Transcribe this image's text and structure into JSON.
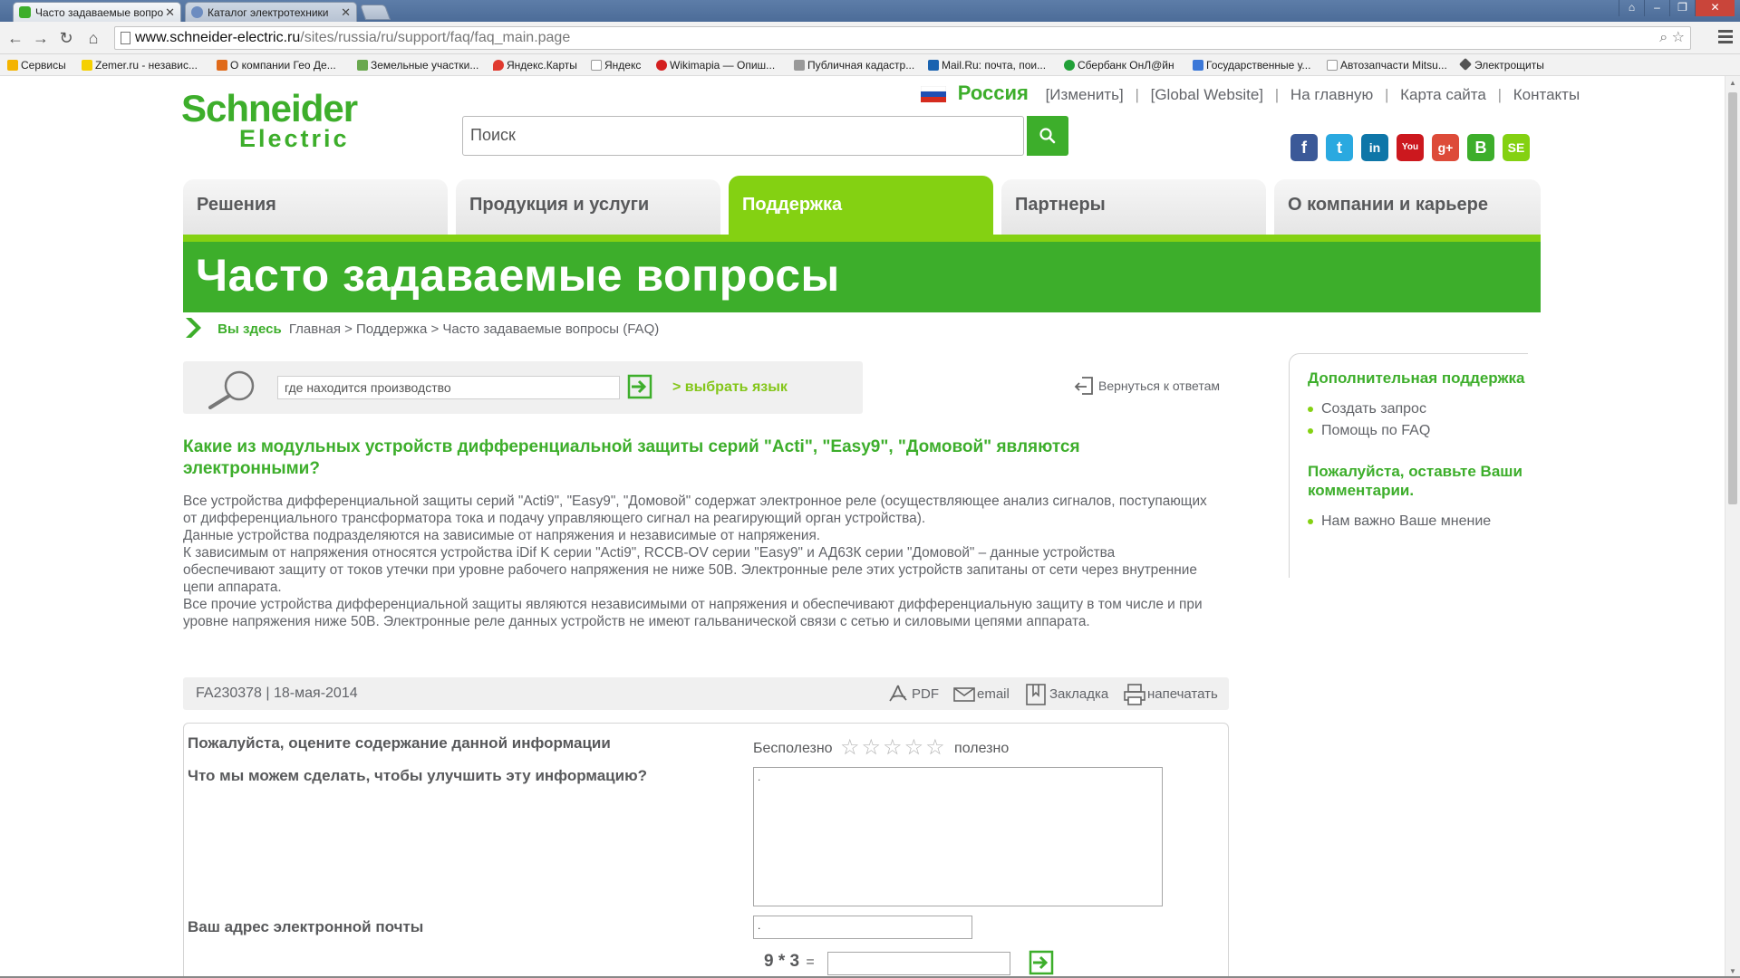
{
  "browser": {
    "tabs": [
      {
        "title": "Часто задаваемые вопро",
        "active": true
      },
      {
        "title": "Каталог электротехники",
        "active": false
      }
    ],
    "url_host": "www.schneider-electric.ru",
    "url_path": "/sites/russia/ru/support/faq/faq_main.page",
    "bookmarks": [
      "Сервисы",
      "Zemer.ru - независ...",
      "О компании Гео Де...",
      "Земельные участки...",
      "Яндекс.Карты",
      "Яндекс",
      "Wikimapia — Опиш...",
      "Публичная кадастр...",
      "Mail.Ru: почта, пои...",
      "Сбербанк ОнЛ@йн",
      "Государственные у...",
      "Автозапчасти Mitsu...",
      "Электрощиты"
    ]
  },
  "header": {
    "logo_line1": "Schneider",
    "logo_line2": "Electric",
    "country": "Россия",
    "top_links": [
      "[Изменить]",
      "[Global Website]",
      "На главную",
      "Карта сайта",
      "Контакты"
    ],
    "search_placeholder": "Поиск",
    "social": [
      {
        "name": "facebook-icon",
        "glyph": "f",
        "color": "#3b5998"
      },
      {
        "name": "twitter-icon",
        "glyph": "t",
        "color": "#2aa9e0"
      },
      {
        "name": "linkedin-icon",
        "glyph": "in",
        "color": "#0e76a8"
      },
      {
        "name": "youtube-icon",
        "glyph": "You",
        "color": "#cc181e"
      },
      {
        "name": "googleplus-icon",
        "glyph": "g+",
        "color": "#dd4b39"
      },
      {
        "name": "vkontakte-icon",
        "glyph": "B",
        "color": "#3dae2b"
      },
      {
        "name": "setv-icon",
        "glyph": "SE",
        "color": "#84d112"
      }
    ]
  },
  "nav": {
    "tabs": [
      "Решения",
      "Продукция и услуги",
      "Поддержка",
      "Партнеры",
      "О компании и карьере"
    ],
    "active_index": 2
  },
  "page_title": "Часто задаваемые вопросы",
  "breadcrumb": {
    "you_are_here": "Вы здесь",
    "path": "Главная > Поддержка > Часто задаваемые вопросы (FAQ)"
  },
  "faq_search": {
    "value": "где находится производство",
    "lang_link": ">  выбрать язык"
  },
  "back_link": "Вернуться к ответам",
  "question": "Какие из модульных устройств дифференциальной защиты серий \"Acti\", \"Easy9\", \"Домовой\" являются электронными?",
  "answer": [
    "Все устройства дифференциальной защиты серий \"Acti9\", \"Easy9\", \"Домовой\" содержат электронное реле (осуществляющее анализ сигналов, поступающих от дифференциального трансформатора тока и подачу управляющего сигнал на реагирующий орган устройства).",
    "Данные устройства подразделяются на зависимые от напряжения и независимые от напряжения.",
    "К зависимым от напряжения относятся устройства iDif K серии \"Acti9\",  RCCB-OV серии \"Easy9\" и АД63К серии \"Домовой\" – данные устройства обеспечивают защиту от токов утечки при уровне рабочего напряжения не ниже 50В. Электронные реле этих устройств запитаны от сети через внутренние цепи аппарата.",
    "Все прочие устройства дифференциальной защиты являются независимыми от напряжения и обеспечивают дифференциальную защиту в том числе и при уровне напряжения ниже 50В. Электронные реле данных устройств не имеют гальванической связи с сетью и силовыми цепями аппарата."
  ],
  "meta": {
    "code": "FA230378",
    "date": "| 18-мая-2014",
    "actions": [
      "PDF",
      "email",
      "Закладка",
      "напечатать"
    ]
  },
  "feedback": {
    "rate_label": "Пожалуйста, оцените содержание данной информации",
    "rate_low": "Бесполезно",
    "rate_high": "полезно",
    "stars": 5,
    "improve_label": "Что мы можем сделать, чтобы улучшить эту информацию?",
    "improve_value": ".",
    "email_label": "Ваш адрес электронной почты",
    "email_value": ".",
    "captcha": "9 * 3",
    "captcha_eq": "="
  },
  "sidebar": {
    "section1_title": "Дополнительная поддержка",
    "section1_items": [
      "Создать запрос",
      "Помощь по FAQ"
    ],
    "section2_title": "Пожалуйста, оставьте Ваши комментарии.",
    "section2_items": [
      "Нам важно Ваше мнение"
    ]
  },
  "colors": {
    "brand_green": "#3dae2b",
    "active_tab_green": "#84d112"
  }
}
